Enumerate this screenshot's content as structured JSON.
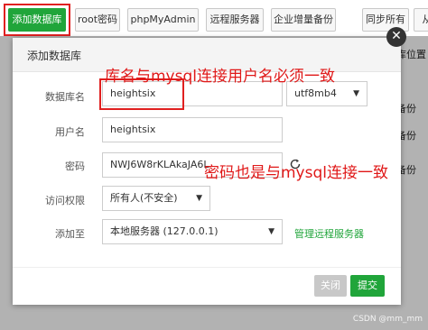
{
  "toolbar": {
    "add_database": "添加数据库",
    "root_password": "root密码",
    "phpmyadmin": "phpMyAdmin",
    "remote_server": "远程服务器",
    "enterprise_backup": "企业增量备份",
    "sync_all": "同步所有",
    "from": "从"
  },
  "background": {
    "col_items": [
      "库位置",
      "备份",
      "备份",
      "备份"
    ]
  },
  "dialog": {
    "title": "添加数据库",
    "db_name_label": "数据库名",
    "db_name_value": "heightsix",
    "charset": "utf8mb4",
    "username_label": "用户名",
    "username_value": "heightsix",
    "password_label": "密码",
    "password_value": "NWJ6W8rKLAkaJA6L",
    "access_label": "访问权限",
    "access_value": "所有人(不安全)",
    "add_to_label": "添加至",
    "add_to_value": "本地服务器 (127.0.0.1)",
    "manage_remote": "管理远程服务器",
    "close_button": "关闭",
    "submit_button": "提交"
  },
  "annotations": {
    "note1": "库名与mysql连接用户名必须一致",
    "note2": "密码也是与mysql连接一致"
  },
  "watermark": "CSDN @mm_mm",
  "colors": {
    "accent": "#20a53a",
    "annotation": "#e01818"
  }
}
